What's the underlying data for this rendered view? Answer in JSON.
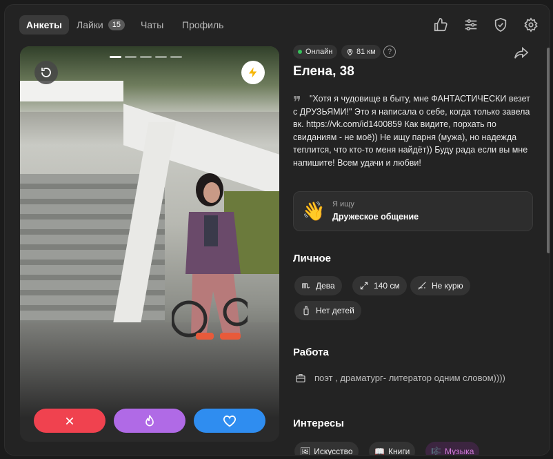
{
  "nav": {
    "tabs": [
      {
        "label": "Анкеты"
      },
      {
        "label": "Лайки",
        "badge": "15"
      },
      {
        "label": "Чаты"
      },
      {
        "label": "Профиль"
      }
    ]
  },
  "profile": {
    "status": "Онлайн",
    "distance": "81 км",
    "name": "Елена, 38",
    "bio": "\"Хотя я чудовище в быту, мне ФАНТАСТИЧЕСКИ везет с ДРУЗЬЯМИ!\" Это я написала о себе, когда только завела вк. https://vk.com/id1400859 Как видите, порхать по свиданиям - не моё)) Не ищу парня (мужа), но надежда теплится, что кто-то меня найдёт)) Буду рада если вы мне напишите! Всем удачи и любви!",
    "seeking": {
      "label": "Я ищу",
      "value": "Дружеское общение"
    },
    "sections": {
      "personal": "Личное",
      "work": "Работа",
      "interests": "Интересы"
    },
    "personal": [
      "Дева",
      "140 см",
      "Не курю",
      "Нет детей"
    ],
    "work": "поэт , драматург- литератор одним словом))))",
    "interests": [
      "Искусство",
      "Книги",
      "Музыка"
    ]
  },
  "colors": {
    "online": "#37c25c",
    "dislike": "#f0424f",
    "superlike": "#b06ae6",
    "like": "#2f8df0",
    "boost": "#f6b70c"
  }
}
